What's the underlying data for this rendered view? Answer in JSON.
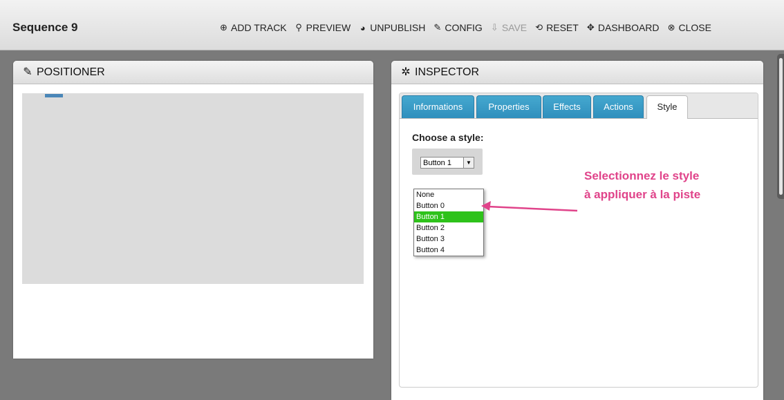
{
  "header": {
    "title": "Sequence 9",
    "toolbar": [
      {
        "name": "add-track-button",
        "icon": "plus-circle-icon",
        "glyph": "⊕",
        "label": "ADD TRACK",
        "enabled": true
      },
      {
        "name": "preview-button",
        "icon": "search-icon",
        "glyph": "⚲",
        "label": "PREVIEW",
        "enabled": true
      },
      {
        "name": "unpublish-button",
        "icon": "globe-icon",
        "glyph": "◕",
        "label": "UNPUBLISH",
        "enabled": true
      },
      {
        "name": "config-button",
        "icon": "wrench-icon",
        "glyph": "✎",
        "label": "CONFIG",
        "enabled": true
      },
      {
        "name": "save-button",
        "icon": "save-icon",
        "glyph": "⇩",
        "label": "SAVE",
        "enabled": false
      },
      {
        "name": "reset-button",
        "icon": "reset-icon",
        "glyph": "⟲",
        "label": "RESET",
        "enabled": true
      },
      {
        "name": "dashboard-button",
        "icon": "dashboard-icon",
        "glyph": "✥",
        "label": "DASHBOARD",
        "enabled": true
      },
      {
        "name": "close-button",
        "icon": "close-circle-icon",
        "glyph": "⊗",
        "label": "CLOSE",
        "enabled": true
      }
    ]
  },
  "positioner": {
    "title": "POSITIONER",
    "icon": "pencil-icon",
    "icon_glyph": "✎"
  },
  "inspector": {
    "title": "INSPECTOR",
    "icon": "gear-icon",
    "icon_glyph": "✲",
    "tabs": [
      {
        "label": "Informations",
        "active": false
      },
      {
        "label": "Properties",
        "active": false
      },
      {
        "label": "Effects",
        "active": false
      },
      {
        "label": "Actions",
        "active": false
      },
      {
        "label": "Style",
        "active": true
      }
    ],
    "style_label": "Choose a style:",
    "selected_value": "Button 1",
    "select_arrow_glyph": "▼",
    "options": [
      "None",
      "Button 0",
      "Button 1",
      "Button 2",
      "Button 3",
      "Button 4"
    ],
    "selected_index": 2
  },
  "annotation": {
    "line1": "Selectionnez le style",
    "line2": "à appliquer à la piste",
    "color": "#e0438a"
  },
  "colors": {
    "tab_blue": "#3a9ac6",
    "selection_green": "#2ec21a",
    "background": "#7a7a7a"
  }
}
